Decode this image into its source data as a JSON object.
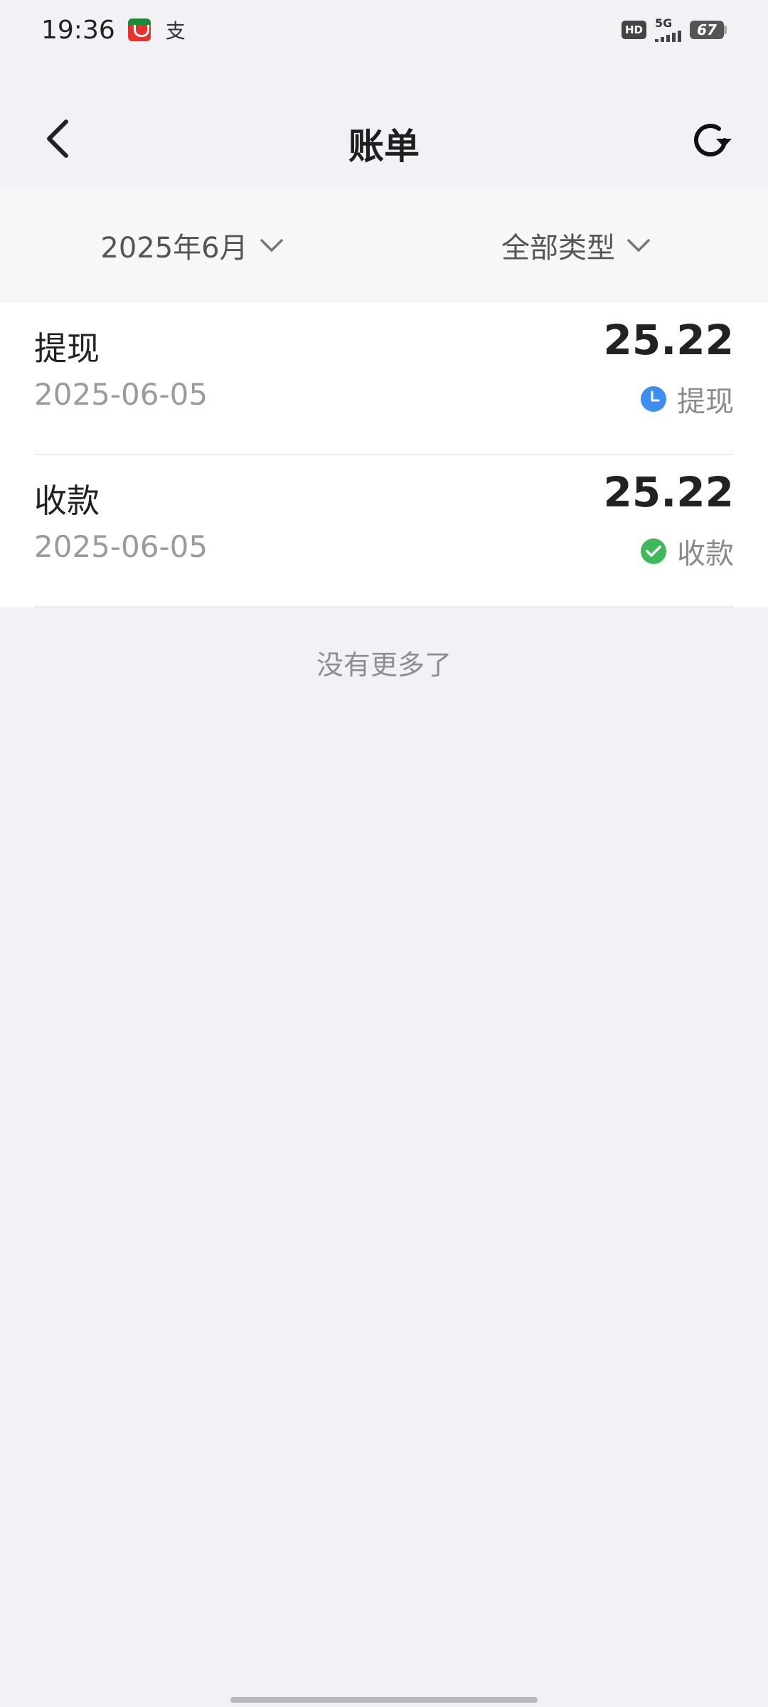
{
  "status_bar": {
    "time": "19:36",
    "alipay_glyph": "支",
    "hd": "HD",
    "network": "5G",
    "battery": "67"
  },
  "header": {
    "title": "账单"
  },
  "filters": {
    "month": "2025年6月",
    "type": "全部类型"
  },
  "bills": [
    {
      "title": "提现",
      "date": "2025-06-05",
      "amount": "25.22",
      "status": "提现",
      "status_icon": "clock-icon",
      "status_color": "#3d8ef0"
    },
    {
      "title": "收款",
      "date": "2025-06-05",
      "amount": "25.22",
      "status": "收款",
      "status_icon": "check-circle-icon",
      "status_color": "#3fb75b"
    }
  ],
  "footer": {
    "end_text": "没有更多了"
  }
}
